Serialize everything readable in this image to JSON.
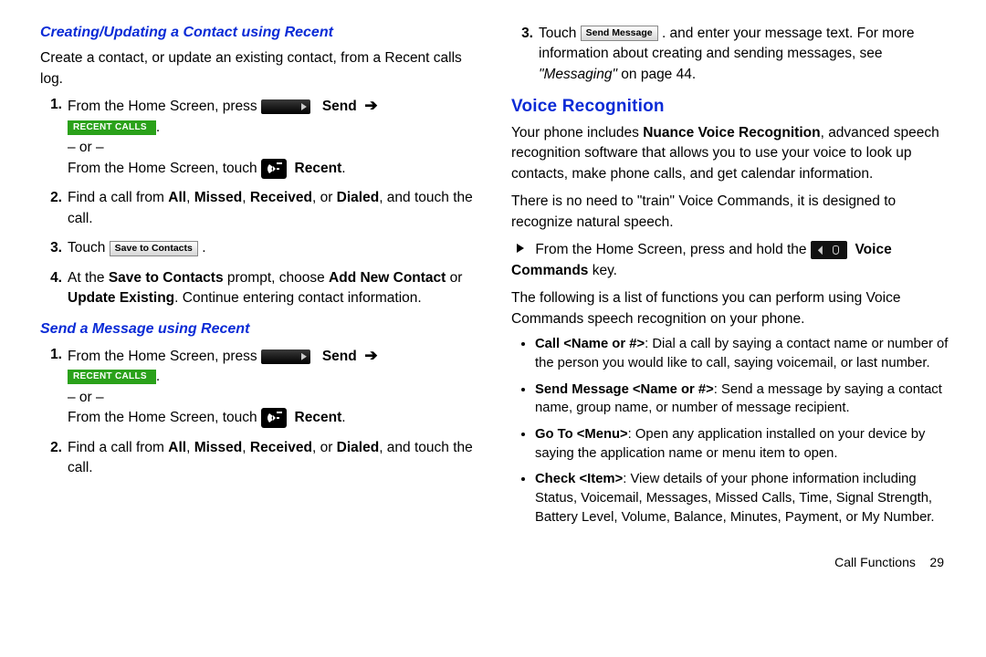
{
  "left": {
    "h1": "Creating/Updating a Contact using Recent",
    "p1": "Create a contact, or update an existing contact, from a Recent calls log.",
    "s1": {
      "n1_pre": "From the Home Screen, press ",
      "n1_send": "Send",
      "n1_recent_calls": "RECENT CALLS",
      "n1_or": "– or –",
      "n1_touch": "From the Home Screen, touch ",
      "n1_recent": "Recent",
      "n2_a": "Find a call from ",
      "n2_all": "All",
      "n2_missed": "Missed",
      "n2_received": "Received",
      "n2_dialed": "Dialed",
      "n2_b": ", and touch the call.",
      "n3_a": "Touch ",
      "n3_btn": "Save to Contacts",
      "n4_a": "At the ",
      "n4_b": "Save to Contacts",
      "n4_c": " prompt, choose ",
      "n4_d": "Add New Contact",
      "n4_e": " or ",
      "n4_f": "Update Existing",
      "n4_g": ". Continue entering contact information."
    },
    "h2": "Send a Message using Recent",
    "s2": {
      "n2_a": "Find a call from ",
      "n2_all": "All",
      "n2_missed": "Missed",
      "n2_received": "Received",
      "n2_dialed": "Dialed",
      "n2_b": ", and touch the call."
    }
  },
  "right": {
    "cont3_a": "Touch ",
    "cont3_btn": "Send Message",
    "cont3_b": ". and enter your message text. For more information about creating and sending messages, see ",
    "cont3_ref": "\"Messaging\"",
    "cont3_c": " on page 44.",
    "h1": "Voice Recognition",
    "p1a": "Your phone includes ",
    "p1b": "Nuance Voice Recognition",
    "p1c": ", advanced speech recognition software that allows you to use your voice to look up contacts, make phone calls, and get calendar information.",
    "p2": "There is no need to \"train\" Voice Commands, it is designed to recognize natural speech.",
    "step_a": "From the Home Screen, press and hold the ",
    "step_b": "Voice Commands",
    "step_c": " key.",
    "p3": "The following is a list of functions you can perform using Voice Commands speech recognition on your phone.",
    "b1_h": "Call <Name or #>",
    "b1_t": ": Dial a call by saying a contact name or number of the person you would like to call, saying voicemail, or last number.",
    "b2_h": "Send Message <Name or #>",
    "b2_t": ": Send a message by saying a contact name, group name, or number of message recipient.",
    "b3_h": "Go To <Menu>",
    "b3_t": ": Open any application installed on your device by saying the application name or menu item to open.",
    "b4_h": "Check <Item>",
    "b4_t": ": View details of your phone information including Status, Voicemail, Messages, Missed Calls, Time, Signal Strength, Battery Level, Volume, Balance, Minutes, Payment, or My Number.",
    "footer_label": "Call Functions",
    "footer_page": "29"
  },
  "markers": {
    "m1": "1.",
    "m2": "2.",
    "m3": "3.",
    "m4": "4."
  },
  "misc": {
    "comma": ", ",
    "comma_or": ", or ",
    "period": "."
  }
}
